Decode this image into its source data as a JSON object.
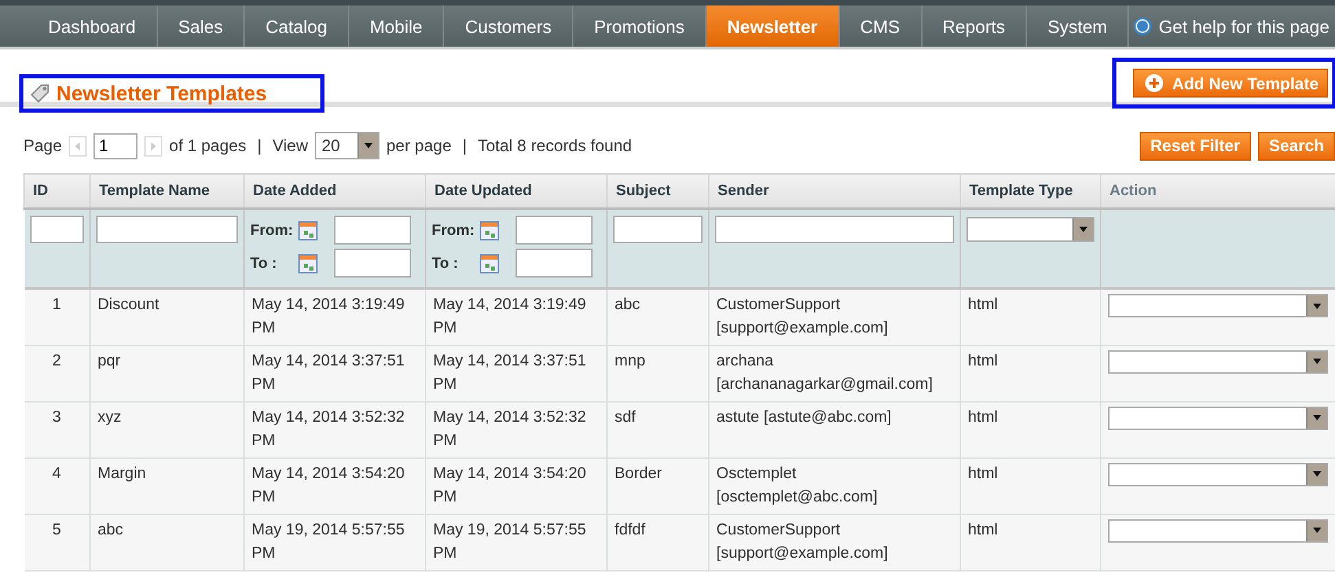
{
  "nav": {
    "tabs": [
      {
        "label": "Dashboard",
        "selected": false
      },
      {
        "label": "Sales",
        "selected": false
      },
      {
        "label": "Catalog",
        "selected": false
      },
      {
        "label": "Mobile",
        "selected": false
      },
      {
        "label": "Customers",
        "selected": false
      },
      {
        "label": "Promotions",
        "selected": false
      },
      {
        "label": "Newsletter",
        "selected": true
      },
      {
        "label": "CMS",
        "selected": false
      },
      {
        "label": "Reports",
        "selected": false
      },
      {
        "label": "System",
        "selected": false
      }
    ],
    "help": "Get help for this page"
  },
  "header": {
    "title": "Newsletter Templates",
    "title_highlighted": true,
    "add_button": "Add New Template",
    "add_button_highlighted": true
  },
  "pager": {
    "page_label": "Page",
    "page": "1",
    "of_pages": "of 1 pages",
    "separator_1": "|",
    "view_label": "View",
    "per_page": "20",
    "per_page_label": "per page",
    "separator_2": "|",
    "total": "Total 8 records found"
  },
  "actions": [
    "Reset Filter",
    "Search"
  ],
  "table": {
    "columns": [
      {
        "label": "ID",
        "sortable": true
      },
      {
        "label": "Template Name",
        "sortable": true
      },
      {
        "label": "Date Added",
        "sortable": true
      },
      {
        "label": "Date Updated",
        "sortable": true
      },
      {
        "label": "Subject",
        "sortable": true
      },
      {
        "label": "Sender",
        "sortable": true
      },
      {
        "label": "Template Type",
        "sortable": true
      },
      {
        "label": "Action",
        "sortable": false
      }
    ],
    "filters": [
      {
        "kind": "text"
      },
      {
        "kind": "text"
      },
      {
        "kind": "date",
        "from": "From:",
        "to": "To :"
      },
      {
        "kind": "date",
        "from": "From:",
        "to": "To :"
      },
      {
        "kind": "text"
      },
      {
        "kind": "text"
      },
      {
        "kind": "select"
      },
      {
        "kind": "none"
      }
    ],
    "rows": [
      {
        "id": "1",
        "name": "Discount",
        "added": "May 14, 2014 3:19:49 PM",
        "updated": "May 14, 2014 3:19:49 PM",
        "subject": "abc",
        "sender": "CustomerSupport [support@example.com]",
        "type": "html"
      },
      {
        "id": "2",
        "name": "pqr",
        "added": "May 14, 2014 3:37:51 PM",
        "updated": "May 14, 2014 3:37:51 PM",
        "subject": "mnp",
        "sender": "archana [archananagarkar@gmail.com]",
        "type": "html"
      },
      {
        "id": "3",
        "name": "xyz",
        "added": "May 14, 2014 3:52:32 PM",
        "updated": "May 14, 2014 3:52:32 PM",
        "subject": "sdf",
        "sender": "astute [astute@abc.com]",
        "type": "html"
      },
      {
        "id": "4",
        "name": "Margin",
        "added": "May 14, 2014 3:54:20 PM",
        "updated": "May 14, 2014 3:54:20 PM",
        "subject": "Border",
        "sender": "Osctemplet [osctemplet@abc.com]",
        "type": "html"
      },
      {
        "id": "5",
        "name": "abc",
        "added": "May 19, 2014 5:57:55 PM",
        "updated": "May 19, 2014 5:57:55 PM",
        "subject": "fdfdf",
        "sender": "CustomerSupport [support@example.com]",
        "type": "html"
      }
    ]
  }
}
